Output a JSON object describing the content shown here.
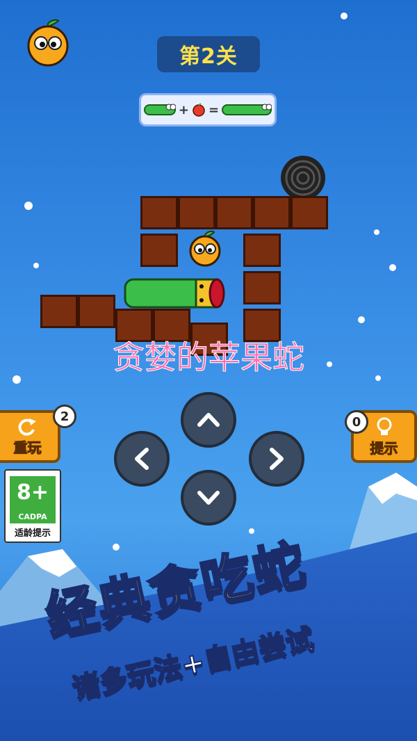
{
  "level": {
    "label": "第2关"
  },
  "goal": {
    "plus": "+",
    "equals": "="
  },
  "overlay_title": "贪婪的苹果蛇",
  "buttons": {
    "replay": {
      "label": "重玩",
      "count": "2"
    },
    "hint": {
      "label": "提示",
      "count": "0"
    }
  },
  "age_rating": {
    "rating": "8+",
    "org": "CADPA",
    "caption": "适龄提示"
  },
  "slogan": {
    "main": "经典贪吃蛇",
    "sub": "诸多玩法+自由尝试"
  },
  "colors": {
    "brick": "#7a2e10",
    "snake": "#3cbf4a",
    "accent": "#f6a21a",
    "pill": "#1c4c8e"
  }
}
